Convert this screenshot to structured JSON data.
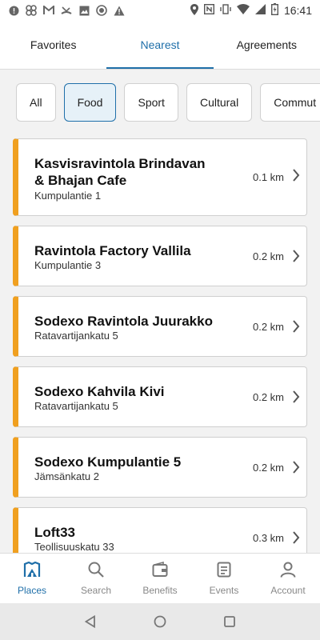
{
  "status_bar": {
    "time": "16:41"
  },
  "tabs": [
    {
      "label": "Favorites",
      "active": false
    },
    {
      "label": "Nearest",
      "active": true
    },
    {
      "label": "Agreements",
      "active": false
    }
  ],
  "filters": [
    {
      "label": "All",
      "active": false
    },
    {
      "label": "Food",
      "active": true
    },
    {
      "label": "Sport",
      "active": false
    },
    {
      "label": "Cultural",
      "active": false
    },
    {
      "label": "Commut",
      "active": false
    }
  ],
  "places": [
    {
      "name": "Kasvisravintola Brindavan & Bhajan Cafe",
      "address": "Kumpulantie 1",
      "distance": "0.1 km"
    },
    {
      "name": "Ravintola Factory Vallila",
      "address": "Kumpulantie 3",
      "distance": "0.2 km"
    },
    {
      "name": "Sodexo Ravintola Juurakko",
      "address": "Ratavartijankatu 5",
      "distance": "0.2 km"
    },
    {
      "name": "Sodexo Kahvila Kivi",
      "address": "Ratavartijankatu 5",
      "distance": "0.2 km"
    },
    {
      "name": "Sodexo Kumpulantie 5",
      "address": "Jämsänkatu 2",
      "distance": "0.2 km"
    },
    {
      "name": "Loft33",
      "address": "Teollisuuskatu 33",
      "distance": "0.3 km"
    }
  ],
  "bottom_nav": [
    {
      "label": "Places",
      "icon": "places-icon",
      "active": true
    },
    {
      "label": "Search",
      "icon": "search-icon",
      "active": false
    },
    {
      "label": "Benefits",
      "icon": "wallet-icon",
      "active": false
    },
    {
      "label": "Events",
      "icon": "events-icon",
      "active": false
    },
    {
      "label": "Account",
      "icon": "account-icon",
      "active": false
    }
  ],
  "colors": {
    "accent": "#1f6fa9",
    "card_stripe": "#f0a020"
  }
}
